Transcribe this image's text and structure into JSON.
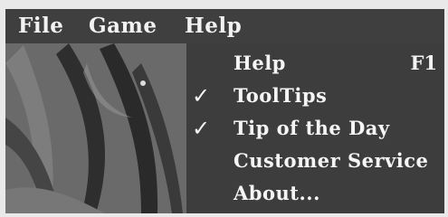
{
  "menubar": {
    "items": [
      "File",
      "Game",
      "Help"
    ]
  },
  "help_menu": {
    "items": [
      {
        "label": "Help",
        "shortcut": "F1",
        "checked": false
      },
      {
        "label": "ToolTips",
        "shortcut": "",
        "checked": true
      },
      {
        "label": "Tip of the Day",
        "shortcut": "",
        "checked": true
      },
      {
        "label": "Customer Service",
        "shortcut": "",
        "checked": false
      },
      {
        "label": "About...",
        "shortcut": "",
        "checked": false
      }
    ],
    "check_glyph": "✓"
  },
  "colors": {
    "menubar": "#3f3f3f",
    "menu_text": "#f2f2f2",
    "background": "#676767"
  }
}
